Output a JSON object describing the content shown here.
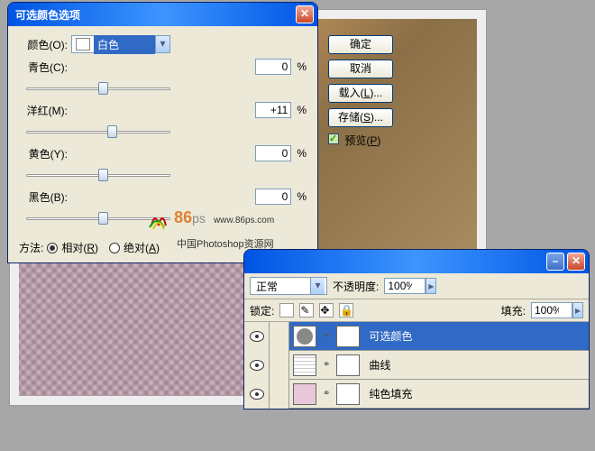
{
  "selective_color": {
    "title": "可选颜色选项",
    "colors_label": "颜色(O):",
    "selected_color": "白色",
    "sliders": {
      "cyan": {
        "label": "青色(C):",
        "value": "0",
        "pos": 50
      },
      "magenta": {
        "label": "洋红(M):",
        "value": "+11",
        "pos": 56
      },
      "yellow": {
        "label": "黄色(Y):",
        "value": "0",
        "pos": 50
      },
      "black": {
        "label": "黑色(B):",
        "value": "0",
        "pos": 50
      }
    },
    "percent": "%",
    "method_label": "方法:",
    "relative": "相对(R)",
    "absolute": "绝对(A)",
    "buttons": {
      "ok": "确定",
      "cancel": "取消",
      "load": "载入(L)...",
      "save": "存储(S)..."
    },
    "preview": "预览(P)"
  },
  "watermark": {
    "brand": "86",
    "sub": "ps",
    "url": "www.86ps.com",
    "cn": "中国Photoshop资源网"
  },
  "layers": {
    "blend": "正常",
    "opacity_label": "不透明度:",
    "opacity": "100%",
    "lock_label": "锁定:",
    "fill_label": "填充:",
    "fill": "100%",
    "items": [
      {
        "name": "可选颜色",
        "selected": true,
        "type": "adj"
      },
      {
        "name": "曲线",
        "selected": false,
        "type": "curves"
      },
      {
        "name": "纯色填充",
        "selected": false,
        "type": "solid"
      }
    ]
  }
}
